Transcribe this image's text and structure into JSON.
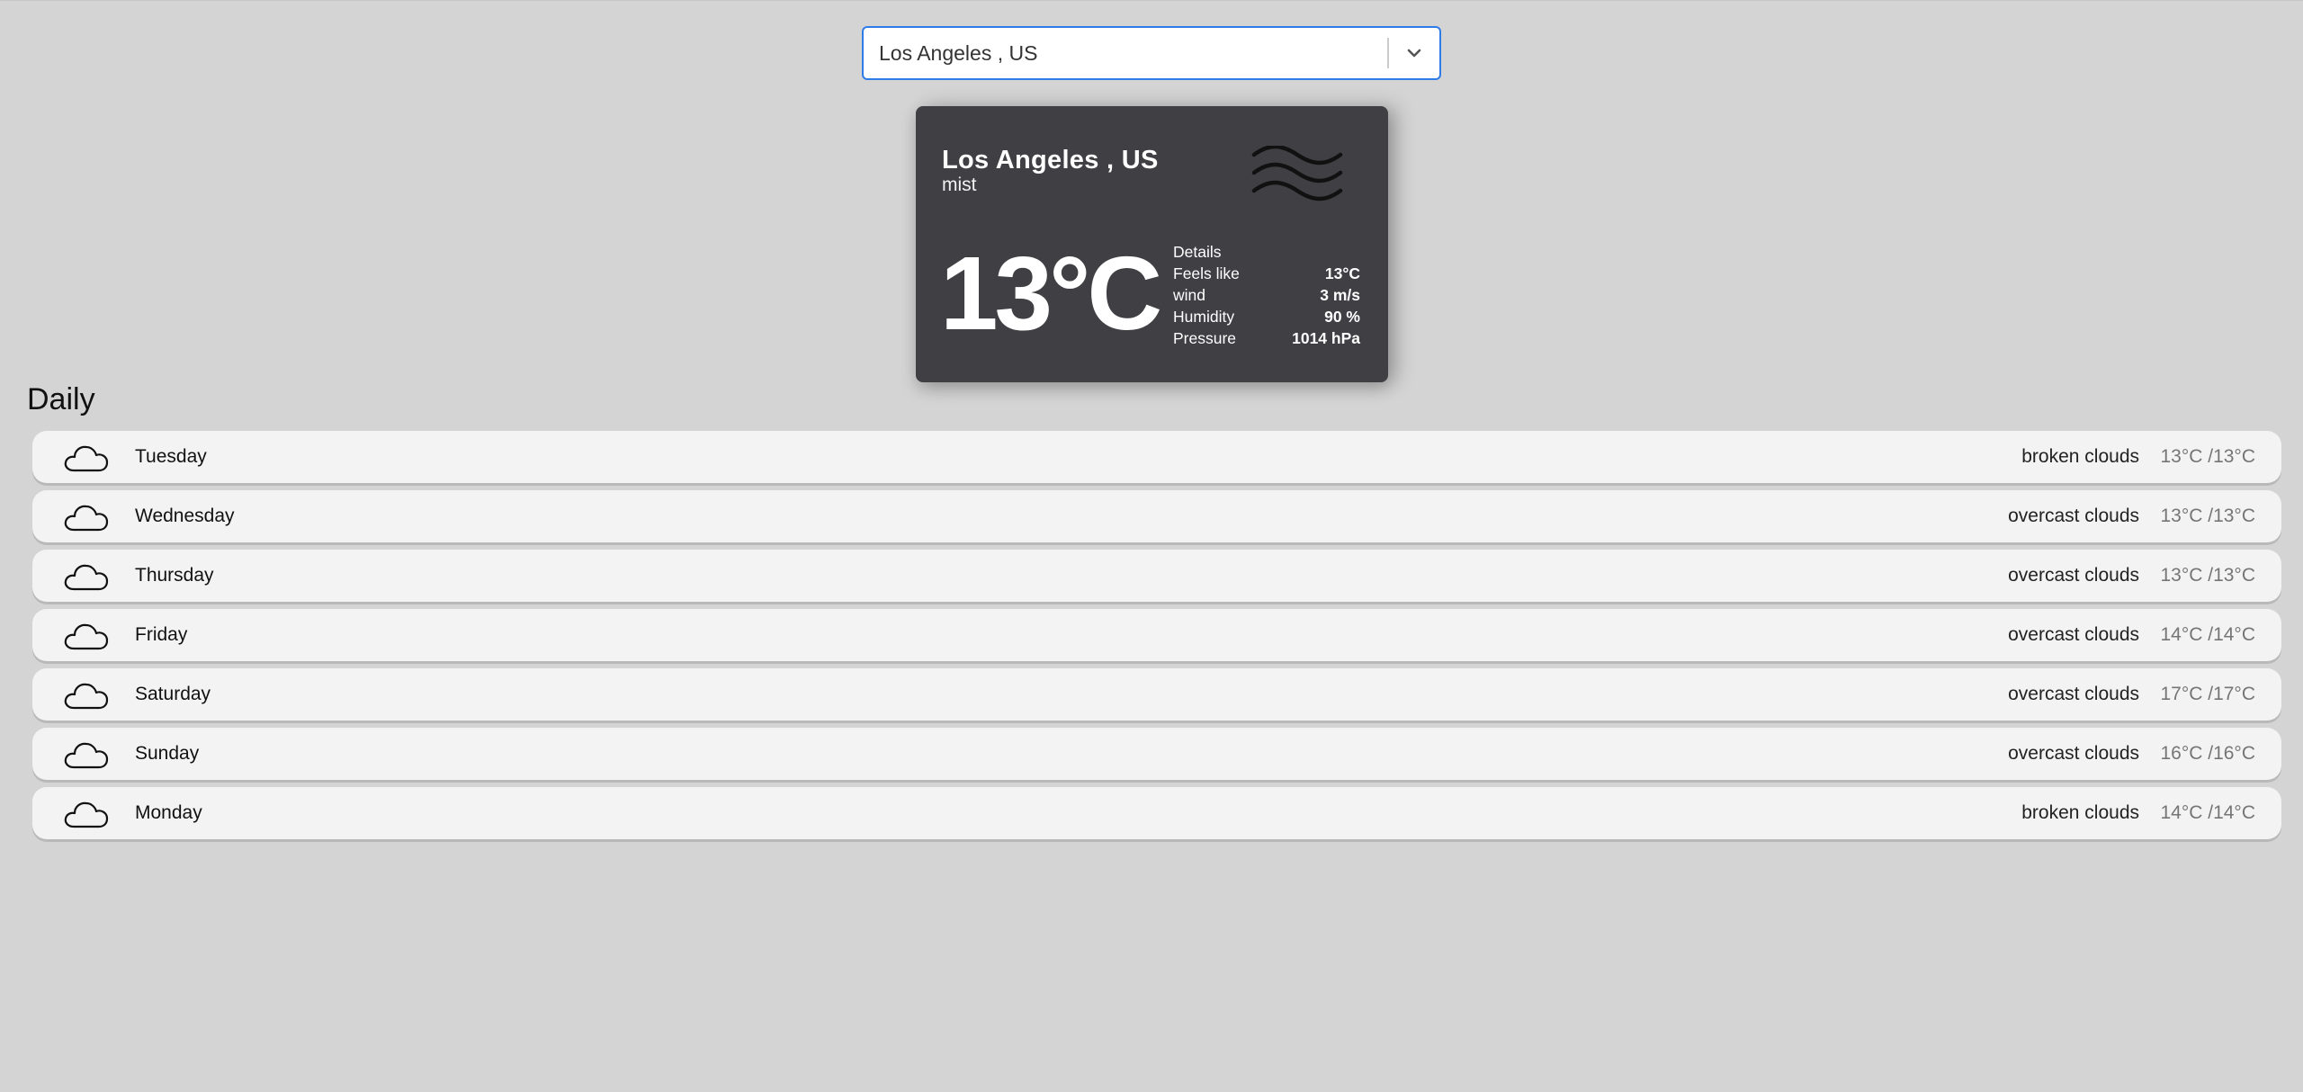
{
  "search": {
    "value": "Los Angeles , US"
  },
  "current": {
    "city": "Los Angeles , US",
    "description": "mist",
    "icon": "mist-icon",
    "temperature": "13°C",
    "details_label": "Details",
    "details": [
      {
        "label": "Feels like",
        "value": "13°C"
      },
      {
        "label": "wind",
        "value": "3 m/s"
      },
      {
        "label": "Humidity",
        "value": "90 %"
      },
      {
        "label": "Pressure",
        "value": "1014 hPa"
      }
    ]
  },
  "daily": {
    "title": "Daily",
    "items": [
      {
        "day": "Tuesday",
        "description": "broken clouds",
        "temp": "13°C /13°C",
        "icon": "cloud-icon"
      },
      {
        "day": "Wednesday",
        "description": "overcast clouds",
        "temp": "13°C /13°C",
        "icon": "cloud-icon"
      },
      {
        "day": "Thursday",
        "description": "overcast clouds",
        "temp": "13°C /13°C",
        "icon": "cloud-icon"
      },
      {
        "day": "Friday",
        "description": "overcast clouds",
        "temp": "14°C /14°C",
        "icon": "cloud-icon"
      },
      {
        "day": "Saturday",
        "description": "overcast clouds",
        "temp": "17°C /17°C",
        "icon": "cloud-icon"
      },
      {
        "day": "Sunday",
        "description": "overcast clouds",
        "temp": "16°C /16°C",
        "icon": "cloud-icon"
      },
      {
        "day": "Monday",
        "description": "broken clouds",
        "temp": "14°C /14°C",
        "icon": "cloud-icon"
      }
    ]
  },
  "colors": {
    "background": "#d4d4d4",
    "card": "#3f3f44",
    "focus_border": "#2f7ce8",
    "list_item": "#f3f3f3"
  }
}
